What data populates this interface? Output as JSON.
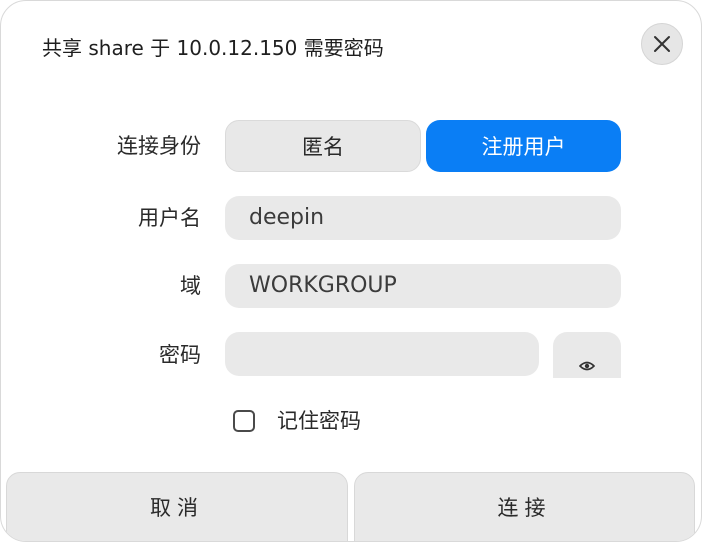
{
  "dialog": {
    "title": "共享 share 于 10.0.12.150 需要密码",
    "close_icon": "close-icon"
  },
  "identity": {
    "label": "连接身份",
    "options": [
      "匿名",
      "注册用户"
    ],
    "selected": "注册用户",
    "accent_color": "#0a7ef5"
  },
  "username": {
    "label": "用户名",
    "value": "deepin"
  },
  "domain": {
    "label": "域",
    "value": "WORKGROUP"
  },
  "password": {
    "label": "密码",
    "value": "",
    "toggle_icon": "eye-icon"
  },
  "remember": {
    "label": "记住密码",
    "checked": false
  },
  "buttons": {
    "cancel": "取消",
    "connect": "连接"
  }
}
